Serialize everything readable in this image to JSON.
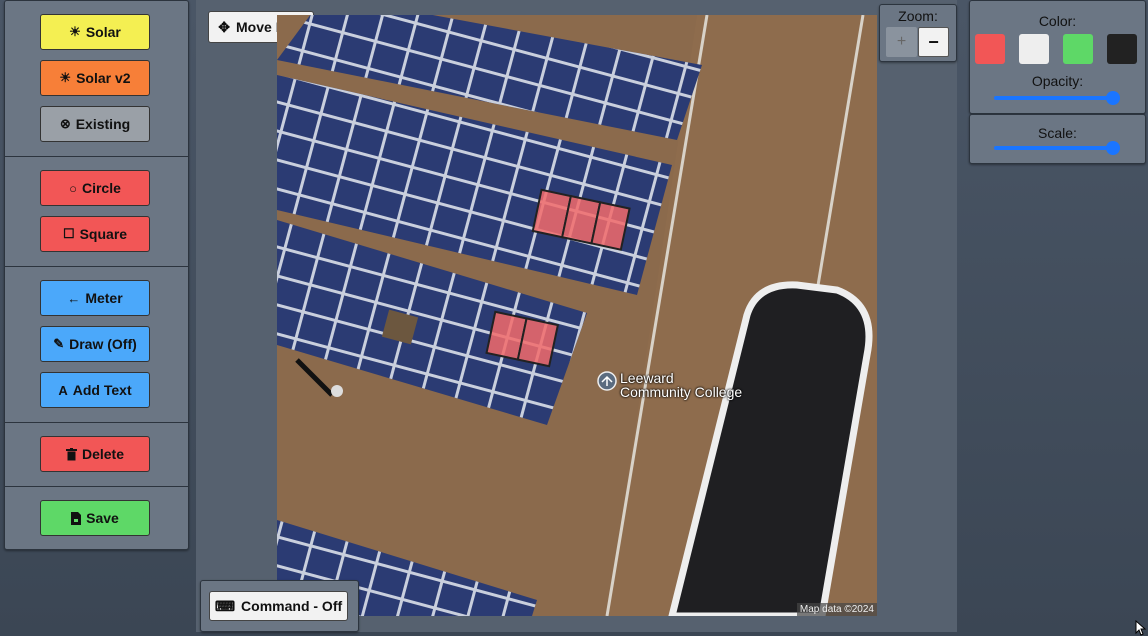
{
  "toolbar": {
    "solar": "Solar",
    "solar_v2": "Solar v2",
    "existing": "Existing",
    "circle": "Circle",
    "square": "Square",
    "meter": "Meter",
    "draw": "Draw (Off)",
    "add_text": "Add Text",
    "delete": "Delete",
    "save": "Save"
  },
  "map": {
    "move_label": "Move Map",
    "command_label": "Command - Off",
    "place_label_line1": "Leeward",
    "place_label_line2": "Community College",
    "attribution": "Map data ©2024"
  },
  "zoom": {
    "label": "Zoom:",
    "plus": "+",
    "minus": "−"
  },
  "style_panel": {
    "color_label": "Color:",
    "colors": [
      "#f25656",
      "#eeeeee",
      "#5ed867",
      "#222222"
    ],
    "opacity_label": "Opacity:",
    "opacity_value": 1.0,
    "scale_label": "Scale:",
    "scale_value": 1.0
  }
}
